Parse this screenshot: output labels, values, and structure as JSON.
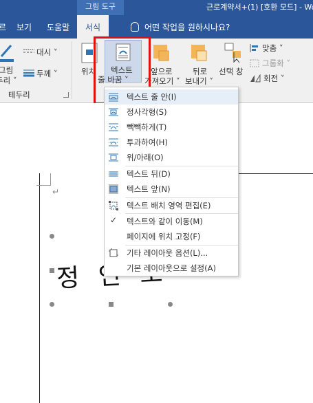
{
  "titlebar": {
    "context_label": "그림 도구",
    "doc_title": "근로계약서+(1) [호환 모드] - Wo"
  },
  "tabs": [
    {
      "label": "르"
    },
    {
      "label": "보기"
    },
    {
      "label": "도움말"
    },
    {
      "label": "서식"
    }
  ],
  "tell_me": "어떤 작업을 원하시나요?",
  "ribbon": {
    "picture_border_label": "그림\n두리",
    "picture_label_1": "그림",
    "picture_label_2": "두리 ˅",
    "dashes_label": "대시",
    "weight_label": "두께",
    "border_group": "테두리",
    "position_label": "위치",
    "wrap_text_label_1": "텍스트",
    "wrap_text_label_2": "줄 바꿈",
    "bring_forward_1": "앞으로",
    "bring_forward_2": "가져오기",
    "send_backward_1": "뒤로",
    "send_backward_2": "보내기",
    "selection_pane": "선택 창",
    "align_label": "맞춤",
    "group_label": "그룹화",
    "rotate_label": "회전"
  },
  "dropdown": {
    "items": [
      {
        "label": "텍스트 줄 안(I)",
        "icon": "inline-wrap-icon"
      },
      {
        "label": "정사각형(S)",
        "icon": "square-wrap-icon"
      },
      {
        "label": "빽빽하게(T)",
        "icon": "tight-wrap-icon"
      },
      {
        "label": "투과하여(H)",
        "icon": "through-wrap-icon"
      },
      {
        "label": "위/아래(O)",
        "icon": "top-bottom-wrap-icon"
      },
      {
        "label": "텍스트 뒤(D)",
        "icon": "behind-text-icon"
      },
      {
        "label": "텍스트 앞(N)",
        "icon": "in-front-text-icon"
      },
      {
        "label": "텍스트 배치 영역 편집(E)",
        "icon": "edit-wrap-points-icon"
      },
      {
        "label": "텍스트와 같이 이동(M)",
        "icon": "check-icon"
      },
      {
        "label": "페이지에 위치 고정(F)",
        "icon": ""
      },
      {
        "label": "기타 레이아웃 옵션(L)...",
        "icon": "layout-options-icon"
      },
      {
        "label": "기본 레이아웃으로 설정(A)",
        "icon": ""
      }
    ]
  },
  "document": {
    "signature_text": "정 인 호",
    "paragraph_mark": "↵"
  },
  "colors": {
    "title_blue": "#2b579a",
    "highlight_red": "#e01010",
    "icon_orange": "#f2b55a",
    "icon_blue": "#2e75b6"
  }
}
